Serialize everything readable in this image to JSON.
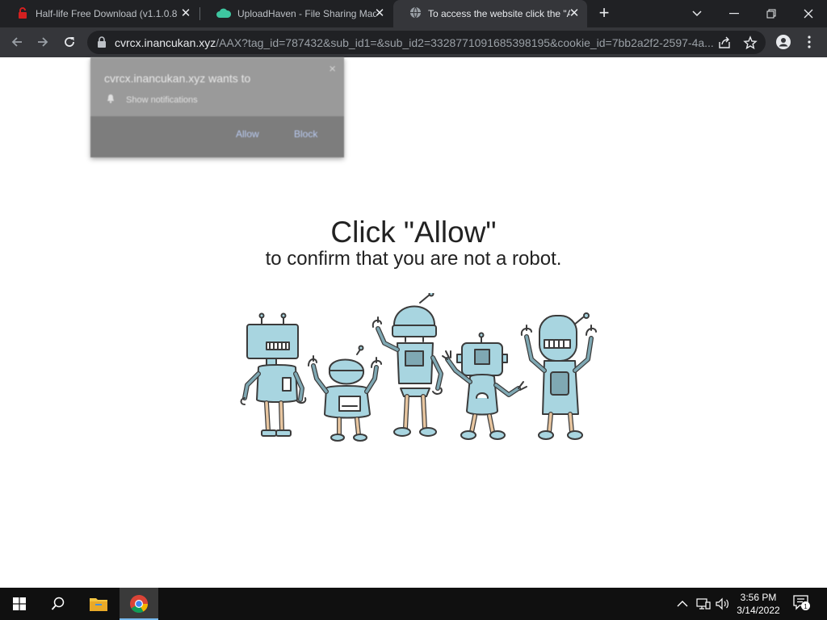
{
  "browser": {
    "tabs": [
      {
        "title": "Half-life Free Download (v1.1.0.8",
        "close": "✕"
      },
      {
        "title": "UploadHaven - File Sharing Made",
        "close": "✕"
      },
      {
        "title": "To access the website click the \"A",
        "close": "✕"
      }
    ],
    "new_tab": "+",
    "address": {
      "host": "cvrcx.inancukan.xyz",
      "path": "/AAX?tag_id=787432&sub_id1=&sub_id2=3328771091685398195&cookie_id=7bb2a2f2-2597-4a..."
    }
  },
  "notification": {
    "title": "cvrcx.inancukan.xyz wants to",
    "close": "×",
    "permission": "Show notifications",
    "allow_label": "Allow",
    "block_label": "Block"
  },
  "page": {
    "heading": "Click \"Allow\"",
    "subheading": "to confirm that you are not a robot."
  },
  "taskbar": {
    "time": "3:56 PM",
    "date": "3/14/2022",
    "notification_count": "1"
  },
  "icons": {
    "tab1": "red-lock-download-icon",
    "tab2": "cloud-icon",
    "tab3": "globe-icon"
  },
  "colors": {
    "tabstrip": "#202124",
    "toolbar": "#35363a",
    "robot_body": "#a8d5e0",
    "taskbar": "#101010"
  }
}
